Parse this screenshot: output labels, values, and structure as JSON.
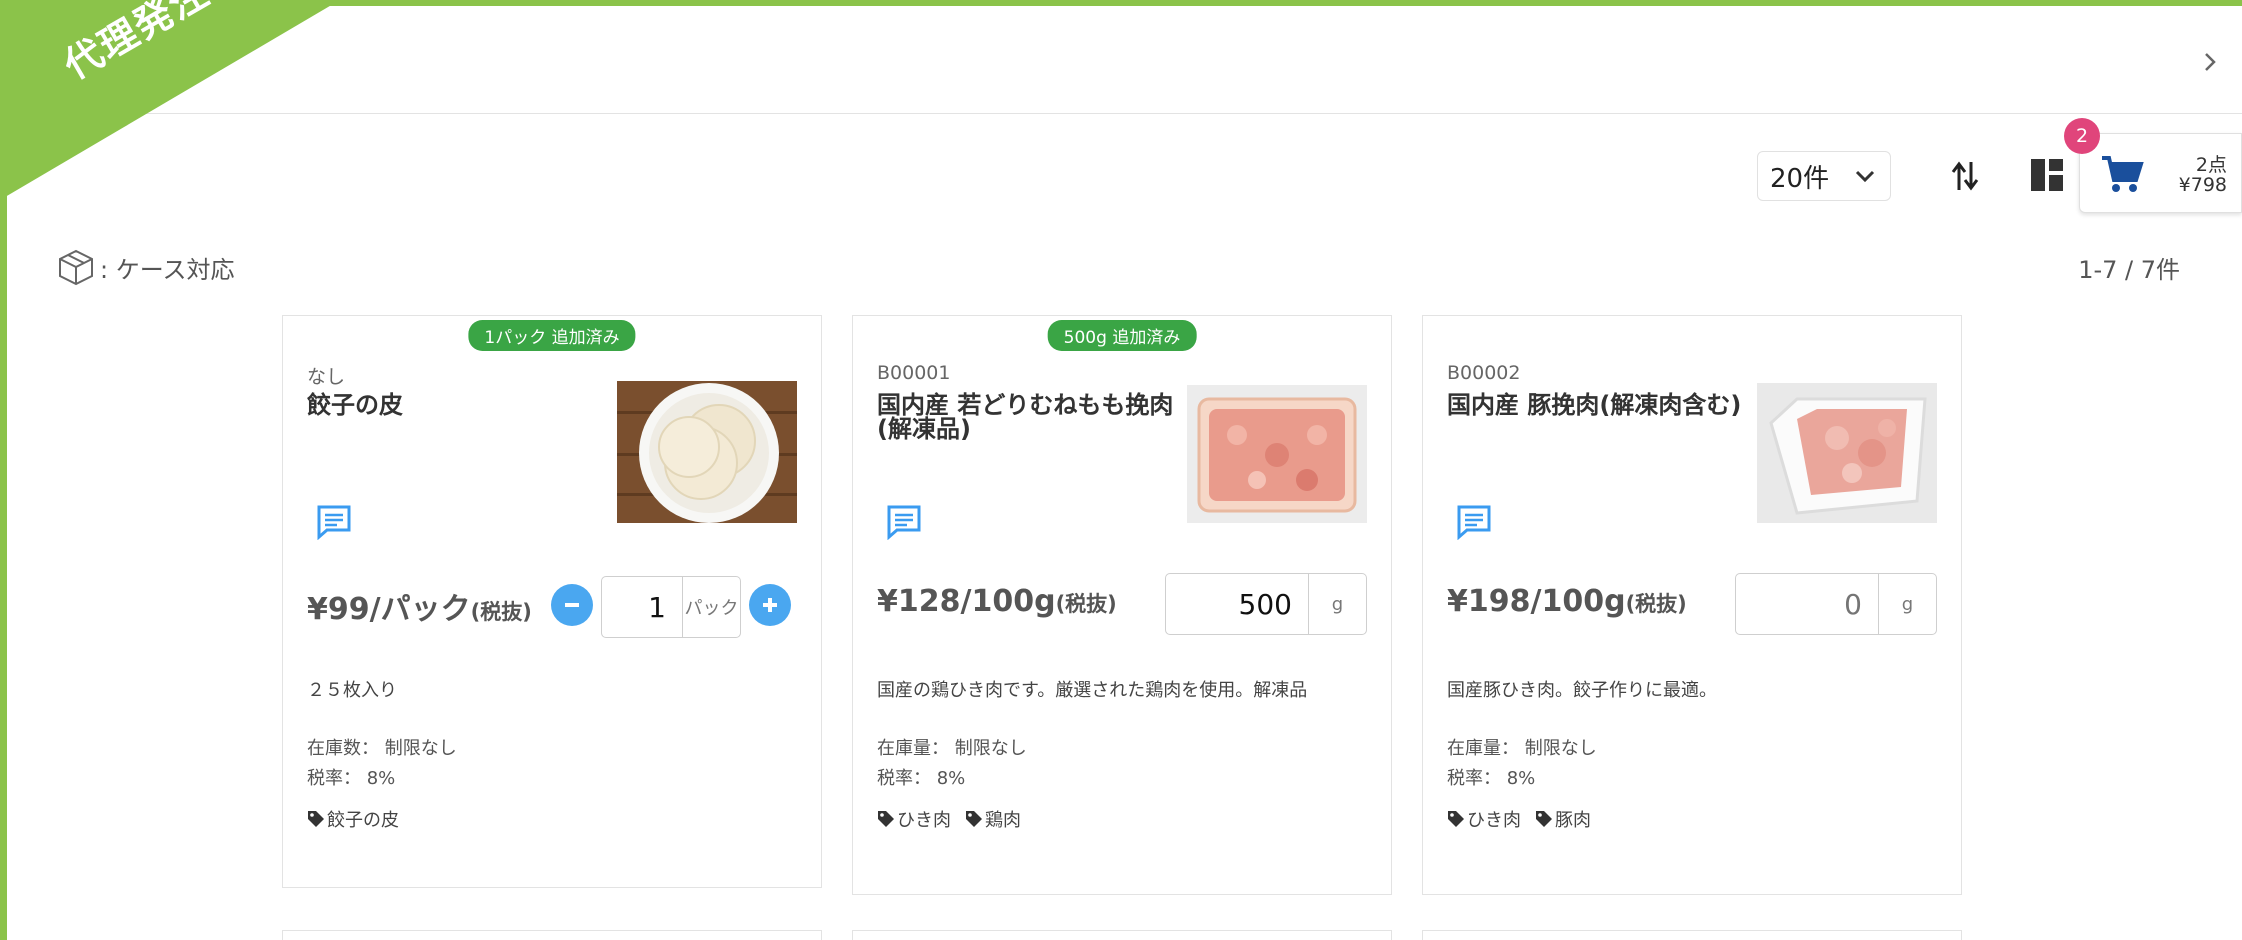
{
  "ribbon": {
    "label": "代理発注"
  },
  "toolbar": {
    "per_page": "20件",
    "cart": {
      "badge": "2",
      "count": "2点",
      "total": "¥798"
    }
  },
  "legend": {
    "label": ": ケース対応"
  },
  "results": {
    "range": "1-7 / 7件"
  },
  "colors": {
    "accent": "#8bc34a",
    "button": "#4aa7f0",
    "badge_added": "#3aa545",
    "cart_badge": "#e0457b",
    "cart_icon": "#1a4f9c"
  },
  "products": [
    {
      "added": "1パック 追加済み",
      "code": "なし",
      "name": "餃子の皮",
      "price": "¥99/パック",
      "tax_label": "(税抜)",
      "qty": "1",
      "unit": "パック",
      "description": "２５枚入り",
      "stock": "在庫数： 制限なし",
      "tax_rate": "税率： 8%",
      "tags": [
        "餃子の皮"
      ],
      "image": "plate-with-dumpling-wrappers"
    },
    {
      "added": "500g 追加済み",
      "code": "B00001",
      "name": "国内産 若どりむねもも挽肉(解凍品)",
      "price": "¥128/100g",
      "tax_label": "(税抜)",
      "qty": "500",
      "unit": "g",
      "description": "国産の鶏ひき肉です。厳選された鶏肉を使用。解凍品",
      "stock": "在庫量： 制限なし",
      "tax_rate": "税率： 8%",
      "tags": [
        "ひき肉",
        "鶏肉"
      ],
      "image": "minced-chicken-tray"
    },
    {
      "added": "",
      "code": "B00002",
      "name": "国内産 豚挽肉(解凍肉含む)",
      "price": "¥198/100g",
      "tax_label": "(税抜)",
      "qty": "",
      "qty_placeholder": "0",
      "unit": "g",
      "description": "国産豚ひき肉。餃子作りに最適。",
      "stock": "在庫量： 制限なし",
      "tax_rate": "税率： 8%",
      "tags": [
        "ひき肉",
        "豚肉"
      ],
      "image": "minced-pork-tray"
    }
  ]
}
